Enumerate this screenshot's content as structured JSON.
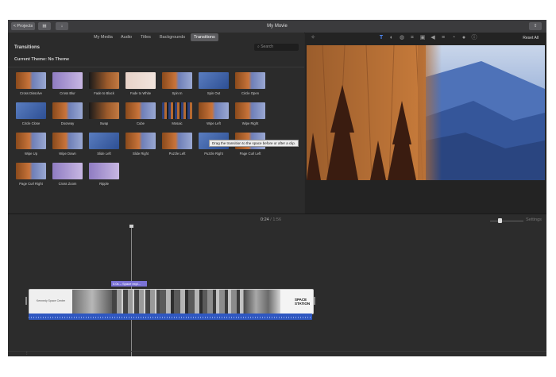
{
  "window": {
    "title": "My Movie",
    "projects_label": "< Projects",
    "share_icon": "share-icon"
  },
  "browser_tabs": {
    "items": [
      "My Media",
      "Audio",
      "Titles",
      "Backgrounds",
      "Transitions"
    ],
    "active": "Transitions"
  },
  "transitions_panel": {
    "title": "Transitions",
    "search_placeholder": "Search",
    "current_theme": "Current Theme: No Theme",
    "tooltip": "Drag the transition to the space before or after a clip."
  },
  "transitions": [
    "Cross Dissolve",
    "Cross Blur",
    "Fade to Black",
    "Fade to White",
    "Spin In",
    "Spin Out",
    "Circle Open",
    "Circle Close",
    "Doorway",
    "Swap",
    "Cube",
    "Mosaic",
    "Wipe Left",
    "Wipe Right",
    "Wipe Up",
    "Wipe Down",
    "Slide Left",
    "Slide Right",
    "Puzzle Left",
    "Puzzle Right",
    "Page Curl Left",
    "Page Curl Right",
    "Cross Zoom",
    "Ripple"
  ],
  "viewer": {
    "reset_label": "Reset All"
  },
  "timeline": {
    "current_time": "0:24",
    "total_time": "1:56",
    "settings_label": "Settings",
    "transition_tag": "0.0s – Space expl...",
    "title_clip_text": "Kennedy Space Center",
    "logo_text": "SPACE STATION",
    "zoom_level": 0.3
  }
}
